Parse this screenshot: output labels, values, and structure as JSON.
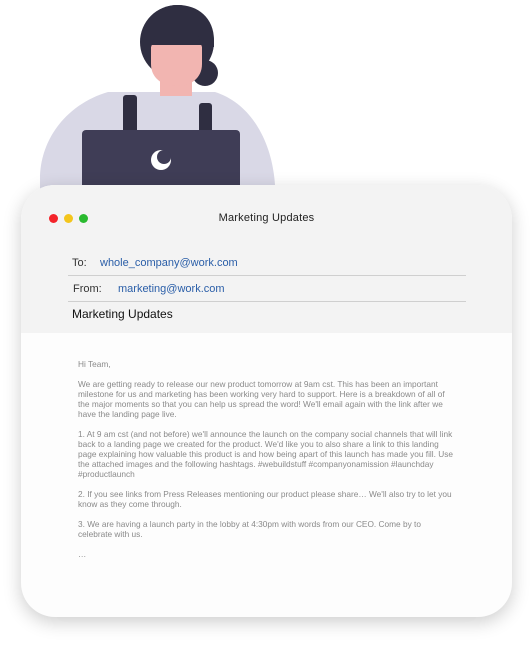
{
  "window": {
    "title": "Marketing Updates",
    "controls": [
      "close",
      "minimize",
      "maximize"
    ]
  },
  "email": {
    "to_label": "To:",
    "to_value": "whole_company@work.com",
    "from_label": "From:",
    "from_value": "marketing@work.com",
    "subject": "Marketing Updates",
    "greeting": "Hi Team,",
    "paragraphs": [
      "We are getting ready to release our new product tomorrow at 9am cst. This has been an important milestone for us and marketing has been working very hard to support. Here is a breakdown of all of the major moments so that you can help us spread the word! We'll email again with the link after we have the landing page live.",
      "1. At 9 am cst (and not before) we'll announce the launch on the company social channels that will link back to a landing page we created for the product. We'd like you to also share a link to this landing page explaining how valuable this product is and how being apart of this launch has made you fill. Use the attached images and the following hashtags. #webuildstuff #companyonamission #launchday #productlaunch",
      "2. If you see links from Press Releases mentioning our product please share… We'll also try to let you know as they come through.",
      "3. We are having a launch party in the lobby at 4:30pm with words from our CEO. Come by to celebrate with us."
    ],
    "ellipsis": "…"
  },
  "colors": {
    "close": "#f3232a",
    "minimize": "#f3c51c",
    "maximize": "#2aba2f",
    "link": "#2a5ea8",
    "header_bg": "#f3f3f3"
  }
}
